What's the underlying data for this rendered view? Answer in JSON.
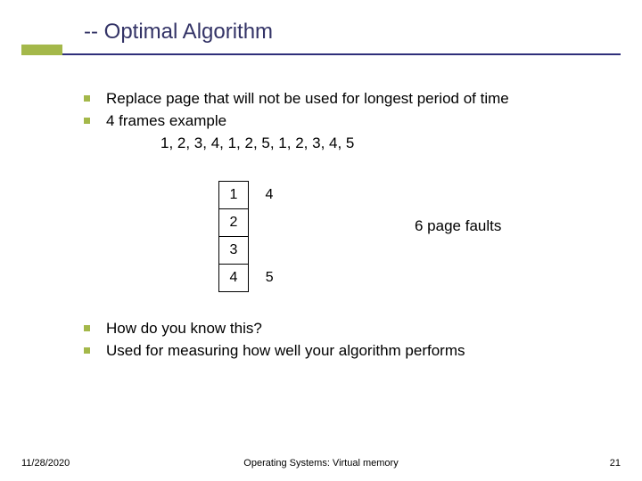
{
  "title": "-- Optimal Algorithm",
  "bullets_top": [
    "Replace page that will not be used for longest period of time",
    "4 frames example"
  ],
  "reference_string": "1, 2, 3, 4, 1, 2, 5, 1, 2, 3, 4, 5",
  "frames": {
    "col1": [
      "1",
      "2",
      "3",
      "4"
    ],
    "col2": [
      "4",
      "",
      "",
      "5"
    ]
  },
  "page_faults_label": "6 page faults",
  "bullets_bottom": [
    "How do you know this?",
    "Used for measuring how well your algorithm performs"
  ],
  "footer": {
    "date": "11/28/2020",
    "center": "Operating Systems: Virtual memory",
    "page": "21"
  }
}
